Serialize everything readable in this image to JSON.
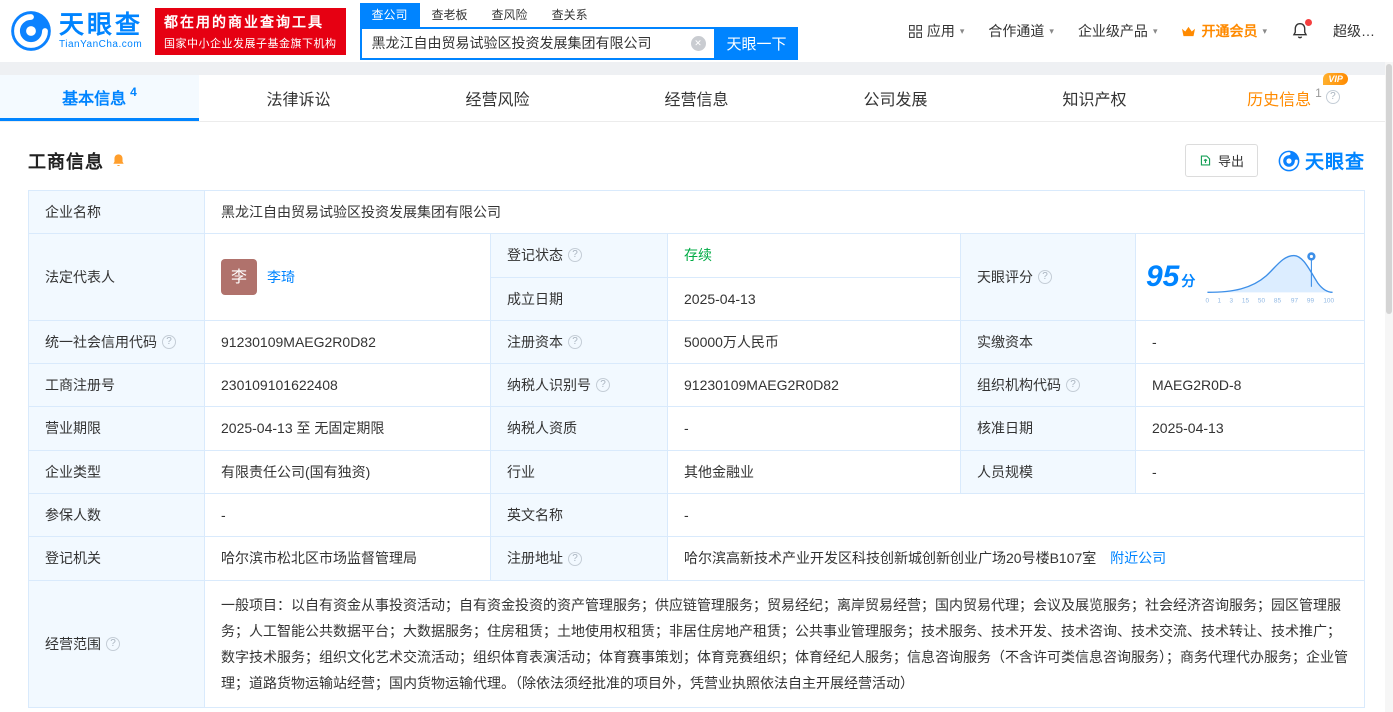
{
  "icons": {
    "caret_down": "▾",
    "clear": "✕",
    "help": "?"
  },
  "header": {
    "logo": {
      "title": "天眼查",
      "domain": "TianYanCha.com"
    },
    "badge": {
      "line1": "都在用的商业查询工具",
      "line2": "国家中小企业发展子基金旗下机构"
    },
    "search": {
      "tabs": [
        {
          "label": "查公司"
        },
        {
          "label": "查老板"
        },
        {
          "label": "查风险"
        },
        {
          "label": "查关系"
        }
      ],
      "value": "黑龙江自由贸易试验区投资发展集团有限公司",
      "button": "天眼一下"
    },
    "nav": {
      "apps": "应用",
      "partner": "合作通道",
      "enterprise": "企业级产品",
      "vip": "开通会员",
      "super": "超级…"
    }
  },
  "tabbar": {
    "tabs": [
      {
        "label": "基本信息",
        "count": "4"
      },
      {
        "label": "法律诉讼"
      },
      {
        "label": "经营风险"
      },
      {
        "label": "经营信息"
      },
      {
        "label": "公司发展"
      },
      {
        "label": "知识产权"
      },
      {
        "label": "历史信息",
        "count": "1",
        "vip": "VIP"
      }
    ]
  },
  "section": {
    "title": "工商信息",
    "export": "导出",
    "brand": "天眼查"
  },
  "info": {
    "company_name": {
      "label": "企业名称",
      "value": "黑龙江自由贸易试验区投资发展集团有限公司"
    },
    "legal_rep": {
      "label": "法定代表人",
      "avatar": "李",
      "name": "李琦"
    },
    "reg_status": {
      "label": "登记状态",
      "value": "存续"
    },
    "establish_date": {
      "label": "成立日期",
      "value": "2025-04-13"
    },
    "score": {
      "label": "天眼评分",
      "value": "95",
      "unit": "分",
      "axis": [
        "0",
        "1",
        "3",
        "15",
        "50",
        "85",
        "97",
        "99",
        "100"
      ]
    },
    "credit_code": {
      "label": "统一社会信用代码",
      "value": "91230109MAEG2R0D82"
    },
    "reg_capital": {
      "label": "注册资本",
      "value": "50000万人民币"
    },
    "paid_capital": {
      "label": "实缴资本",
      "value": "-"
    },
    "reg_number": {
      "label": "工商注册号",
      "value": "230109101622408"
    },
    "taxpayer_id": {
      "label": "纳税人识别号",
      "value": "91230109MAEG2R0D82"
    },
    "org_code": {
      "label": "组织机构代码",
      "value": "MAEG2R0D-8"
    },
    "business_term": {
      "label": "营业期限",
      "value": "2025-04-13 至 无固定期限"
    },
    "taxpayer_quali": {
      "label": "纳税人资质",
      "value": "-"
    },
    "approval_date": {
      "label": "核准日期",
      "value": "2025-04-13"
    },
    "company_type": {
      "label": "企业类型",
      "value": "有限责任公司(国有独资)"
    },
    "industry": {
      "label": "行业",
      "value": "其他金融业"
    },
    "staff_size": {
      "label": "人员规模",
      "value": "-"
    },
    "insured_count": {
      "label": "参保人数",
      "value": "-"
    },
    "english_name": {
      "label": "英文名称",
      "value": "-"
    },
    "reg_authority": {
      "label": "登记机关",
      "value": "哈尔滨市松北区市场监督管理局"
    },
    "reg_address": {
      "label": "注册地址",
      "value": "哈尔滨高新技术产业开发区科技创新城创新创业广场20号楼B107室",
      "nearby": "附近公司"
    },
    "business_scope": {
      "label": "经营范围",
      "value": "一般项目：以自有资金从事投资活动；自有资金投资的资产管理服务；供应链管理服务；贸易经纪；离岸贸易经营；国内贸易代理；会议及展览服务；社会经济咨询服务；园区管理服务；人工智能公共数据平台；大数据服务；住房租赁；土地使用权租赁；非居住房地产租赁；公共事业管理服务；技术服务、技术开发、技术咨询、技术交流、技术转让、技术推广；数字技术服务；组织文化艺术交流活动；组织体育表演活动；体育赛事策划；体育竞赛组织；体育经纪人服务；信息咨询服务（不含许可类信息咨询服务）；商务代理代办服务；企业管理；道路货物运输站经营；国内货物运输代理。（除依法须经批准的项目外，凭营业执照依法自主开展经营活动）"
    }
  }
}
